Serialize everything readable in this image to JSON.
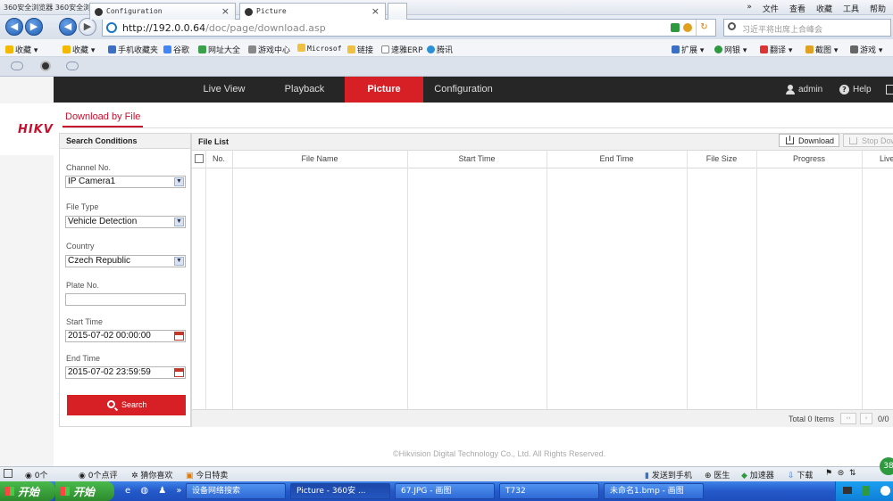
{
  "browser": {
    "title": "360安全浏览器  360安全浏览器 7.1",
    "menu": [
      "»",
      "文件",
      "查看",
      "收藏",
      "工具",
      "帮助"
    ],
    "url_host": "http://192.0.0.64",
    "url_path": "/doc/page/download.asp",
    "search_placeholder": "习近平将出席上合峰会",
    "favorites": [
      "收藏",
      "收藏",
      "手机收藏夹",
      "谷歌",
      "网址大全",
      "游戏中心",
      "Microsof",
      "链接",
      "速雅ERP",
      "腾讯"
    ],
    "fav_right": [
      "扩展",
      "网银",
      "翻译",
      "截图",
      "游戏"
    ],
    "tabs": [
      {
        "label": "Configuration"
      },
      {
        "label": "Picture"
      }
    ]
  },
  "logo": "HIKVISION",
  "topnav": {
    "items": [
      "Live View",
      "Playback",
      "Picture",
      "Configuration"
    ],
    "active": "Picture",
    "user": "admin",
    "help": "Help"
  },
  "page": {
    "subtitle": "Download by File",
    "search_conditions": "Search Conditions",
    "channel_label": "Channel No.",
    "channel_value": "IP Camera1",
    "filetype_label": "File Type",
    "filetype_value": "Vehicle Detection",
    "country_label": "Country",
    "country_value": "Czech Republic",
    "plate_label": "Plate No.",
    "plate_value": "",
    "start_label": "Start Time",
    "start_value": "2015-07-02 00:00:00",
    "end_label": "End Time",
    "end_value": "2015-07-02 23:59:59",
    "search_button": "Search"
  },
  "filelist": {
    "title": "File List",
    "download_button": "Download",
    "stop_button": "Stop Dow",
    "columns": [
      "No.",
      "File Name",
      "Start Time",
      "End Time",
      "File Size",
      "Progress",
      "Live"
    ],
    "total": "Total 0 Items",
    "page_ind": "0/0"
  },
  "copyright": "©Hikvision Digital Technology Co., Ltd. All Rights Reserved.",
  "statusbar": {
    "items": [
      "0个",
      "0个点评",
      "猜你喜欢",
      "今日特卖"
    ],
    "right": [
      "发送到手机",
      "医生",
      "加速器",
      "下载"
    ]
  },
  "taskbar": {
    "start1": "开始",
    "start2": "开始",
    "tasks": [
      "设备网络搜索",
      "Picture - 360安 ...",
      "67.JPG - 画图",
      "T732",
      "未命名1.bmp - 画图"
    ],
    "badge": "38"
  }
}
